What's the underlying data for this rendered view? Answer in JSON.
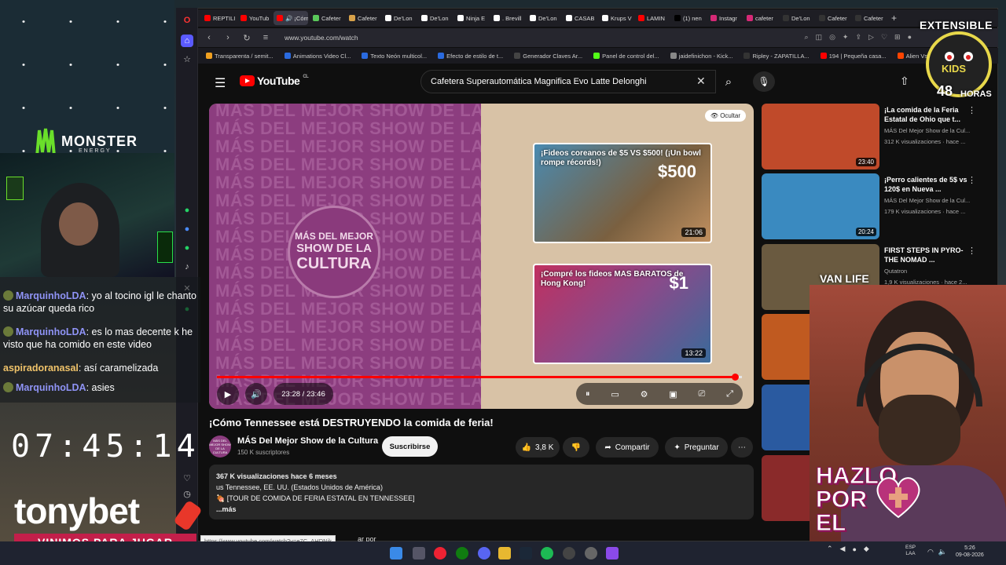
{
  "browser": {
    "tabs": [
      {
        "label": "REPTILI",
        "color": "#ff0000",
        "active": false
      },
      {
        "label": "YouTub",
        "color": "#ff0000",
        "active": false
      },
      {
        "label": "🔊 ¡Cómo Te",
        "color": "#ff0000",
        "active": true
      },
      {
        "label": "Cafeter",
        "color": "#5ac85a",
        "active": false
      },
      {
        "label": "Cafeter",
        "color": "#d8a24a",
        "active": false
      },
      {
        "label": "De'Lon",
        "color": "#ffffff",
        "active": false
      },
      {
        "label": "De'Lon",
        "color": "#ffffff",
        "active": false
      },
      {
        "label": "Ninja E",
        "color": "#ffffff",
        "active": false
      },
      {
        "label": ". Brevill",
        "color": "#ffffff",
        "active": false
      },
      {
        "label": "De'Lon",
        "color": "#ffffff",
        "active": false
      },
      {
        "label": "CASAB",
        "color": "#ffffff",
        "active": false
      },
      {
        "label": "Krups V",
        "color": "#ffffff",
        "active": false
      },
      {
        "label": "LAMIN",
        "color": "#ff0000",
        "active": false
      },
      {
        "label": "(1) nen",
        "color": "#000000",
        "active": false
      },
      {
        "label": "Instagr",
        "color": "#d62976",
        "active": false
      },
      {
        "label": "cafeter",
        "color": "#d62976",
        "active": false
      },
      {
        "label": "De'Lon",
        "color": "#333333",
        "active": false
      },
      {
        "label": "Cafeter",
        "color": "#333333",
        "active": false
      },
      {
        "label": "Cafeter",
        "color": "#333333",
        "active": false
      }
    ],
    "url": "www.youtube.com/watch",
    "bookmarks": [
      {
        "label": "Transparenta / semit...",
        "color": "#f0a020"
      },
      {
        "label": "Animations Video Cl...",
        "color": "#2a6adf"
      },
      {
        "label": "Texto Neón multicol...",
        "color": "#2a6adf"
      },
      {
        "label": "Efecto de estilo de t...",
        "color": "#2a6adf"
      },
      {
        "label": "Generador Claves Ar...",
        "color": "#444444"
      },
      {
        "label": "Panel de control del...",
        "color": "#53fc18"
      },
      {
        "label": "jaidefinichon - Kick...",
        "color": "#888888"
      },
      {
        "label": "Ripley - ZAPATILLA...",
        "color": "#333333"
      },
      {
        "label": "194 | Pequeña casa...",
        "color": "#ff0000"
      },
      {
        "label": "Alien Vs Predato",
        "color": "#ff4400"
      }
    ]
  },
  "youtube": {
    "logo_text": "YouTube",
    "country": "CL",
    "search_value": "Cafetera Superautomática Magnifica Evo Latte Delonghi",
    "player": {
      "watermark_text": "MÁS DEL MEJOR SHOW DE LA CULTURA",
      "circle_lines": [
        "MÁS DEL MEJOR",
        "SHOW DE LA",
        "CULTURA"
      ],
      "hide_label": "Ocultar",
      "end_cards": [
        {
          "title": "¡Fideos coreanos de $5 VS $500! (¡Un bowl rompe récords!)",
          "duration": "21:06",
          "price_tag": "$500"
        },
        {
          "title": "¡Compré los fideos MAS BARATOS de Hong Kong!",
          "duration": "13:22",
          "price_tag": "$1"
        }
      ],
      "time": "23:28 / 23:46",
      "progress": 0.987
    },
    "video": {
      "title": "¡Cómo Tennessee está DESTRUYENDO la comida de feria!",
      "channel": "MÁS Del Mejor Show de la Cultura",
      "channel_avatar_text": "MÁS DEL MEJOR SHOW DE LA CULTURA",
      "subscribers": "150 K suscriptores",
      "subscribe_label": "Suscribirse",
      "likes": "3,8 K",
      "share_label": "Compartir",
      "ask_label": "Preguntar",
      "views_line": "367 K visualizaciones  hace 6 meses",
      "location": "us Tennessee, EE. UU. (Estados Unidos de América)",
      "desc_line": "🍖 [TOUR DE COMIDA DE FERIA ESTATAL EN TENNESSEE]",
      "more_label": "...más"
    },
    "status_url": "https://www.youtube.com/watch?v=e7C_AHDNik",
    "comments_cut": "ar por",
    "recommendations": [
      {
        "title": "¡La comida de la Feria Estatal de Ohio que t...",
        "channel": "MÁS Del Mejor Show de la Cul...",
        "meta": "312 K visualizaciones · hace ...",
        "duration": "23:40",
        "thumb": "#c04a2a"
      },
      {
        "title": "¡Perro calientes de 5$ vs 120$ en Nueva ...",
        "channel": "MÁS Del Mejor Show de la Cul...",
        "meta": "179 K visualizaciones · hace ...",
        "duration": "20:24",
        "thumb": "#3a8ac0"
      },
      {
        "title": "FIRST STEPS IN PYRO-THE NOMAD ...",
        "channel": "Qutatron",
        "meta": "1,9 K visualizaciones · hace 2...",
        "duration": "",
        "thumb": "#6a5a40",
        "thumb_text": "VAN LIFE"
      },
      {
        "title": "",
        "channel": "",
        "meta": "",
        "duration": "",
        "thumb": "#c05a20",
        "thumb_text": "PE"
      },
      {
        "title": "",
        "channel": "",
        "meta": "",
        "duration": "",
        "thumb": "#2a5aa0",
        "thumb_text": ""
      },
      {
        "title": "",
        "channel": "",
        "meta": "",
        "duration": "",
        "thumb": "#8a2a2a",
        "thumb_text": ""
      }
    ]
  },
  "stream": {
    "chat": [
      {
        "user": "MarquinhoLDA",
        "text": ": yo al tocino igl le chanto su azúcar queda rico",
        "style": "1"
      },
      {
        "user": "MarquinhoLDA",
        "text": ": es lo mas decente k he visto que ha comido en este video",
        "style": "1"
      },
      {
        "user": "aspiradoranasal",
        "text": ": así caramelizada",
        "style": "2"
      },
      {
        "user": "MarquinhoLDA",
        "text": ": asies",
        "style": "1"
      }
    ],
    "clock": "07:45:14",
    "sponsor": "tonybet",
    "sponsor_tagline": "VINIMOS PARA JUGAR",
    "monster_text": "MONSTER",
    "monster_sub": "ENERGY",
    "hazlo_lines": [
      "HAZLO",
      "POR",
      "EL"
    ],
    "badge_top": "EXTENSIBLE",
    "badge_mid": "KIDS",
    "badge_num": "48",
    "badge_hours": "HORAS"
  },
  "taskbar": {
    "lang": [
      "ESP",
      "LAA"
    ],
    "time": "5:26",
    "date": "09-08-2026"
  }
}
